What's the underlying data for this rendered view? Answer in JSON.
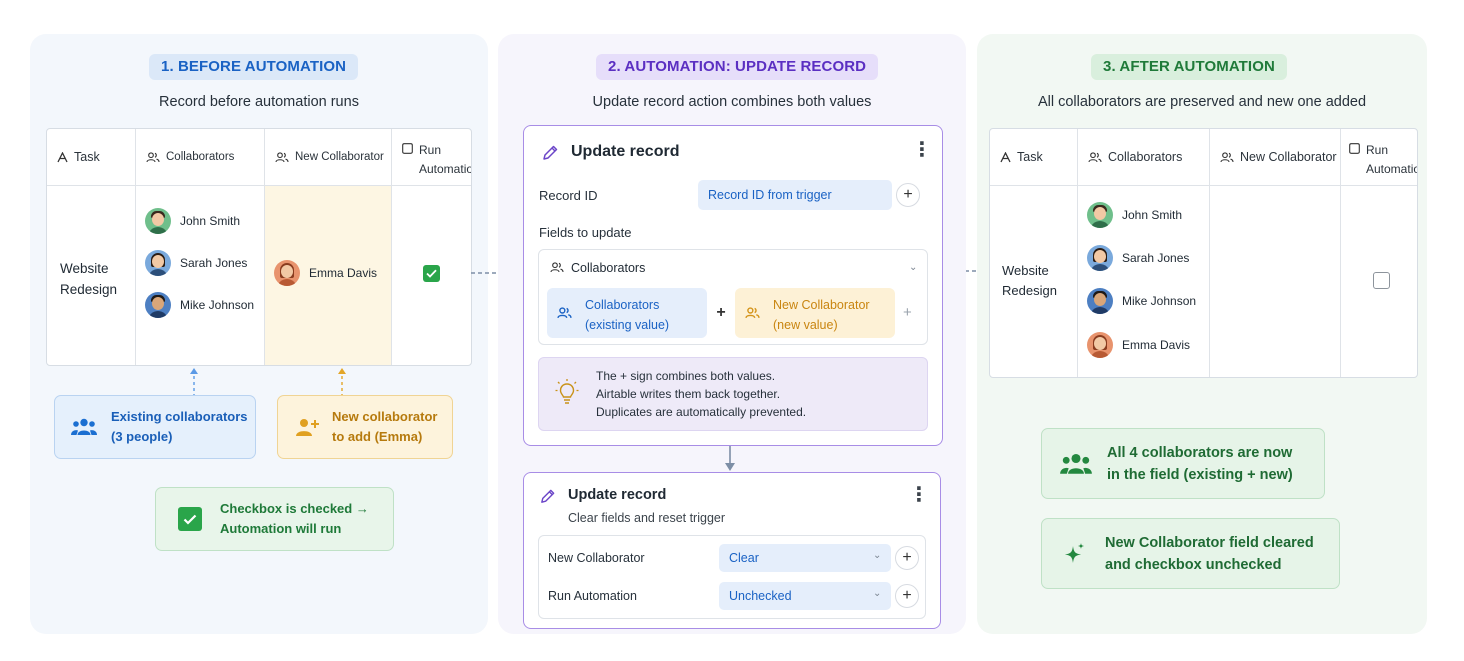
{
  "panel1": {
    "pill": "1. BEFORE AUTOMATION",
    "subtitle": "Record before automation runs",
    "table": {
      "headers": {
        "task": "Task",
        "collaborators": "Collaborators",
        "new_collaborator": "New Collaborator",
        "run": "Run Automation"
      },
      "task_value": "Website Redesign",
      "collaborators": [
        "John Smith",
        "Sarah Jones",
        "Mike Johnson"
      ],
      "new_collaborator": "Emma Davis"
    },
    "note_existing": {
      "line1": "Existing collaborators",
      "line2": "(3 people)"
    },
    "note_new": {
      "line1": "New collaborator",
      "line2": "to add (Emma)"
    },
    "note_checkbox": {
      "line1": "Checkbox is checked →",
      "line2": "Automation will run"
    }
  },
  "panel2": {
    "pill": "2. AUTOMATION: UPDATE RECORD",
    "subtitle": "Update record action combines both values",
    "card1": {
      "title": "Update record",
      "record_id_label": "Record ID",
      "record_id_value": "Record ID from trigger",
      "fields_label": "Fields to update",
      "collab_field": "Collaborators",
      "token_existing": {
        "line1": "Collaborators",
        "line2": "(existing value)"
      },
      "token_new": {
        "line1": "New Collaborator",
        "line2": "(new value)"
      },
      "tip": {
        "line1": "The + sign combines both values.",
        "line2": "Airtable writes them back together.",
        "line3": "Duplicates are automatically prevented."
      }
    },
    "card2": {
      "title": "Update record",
      "subtitle": "Clear fields and reset trigger",
      "rows": [
        {
          "label": "New Collaborator",
          "value": "Clear"
        },
        {
          "label": "Run Automation",
          "value": "Unchecked"
        }
      ]
    }
  },
  "panel3": {
    "pill": "3. AFTER AUTOMATION",
    "subtitle": "All collaborators are preserved and new one added",
    "table": {
      "headers": {
        "task": "Task",
        "collaborators": "Collaborators",
        "new_collaborator": "New Collaborator",
        "run": "Run Automation"
      },
      "task_value": "Website Redesign",
      "collaborators": [
        "John Smith",
        "Sarah Jones",
        "Mike Johnson",
        "Emma Davis"
      ]
    },
    "note_all": {
      "line1": "All 4 collaborators are now",
      "line2": "in the field (existing + new)"
    },
    "note_cleared": {
      "line1": "New Collaborator field cleared",
      "line2": "and checkbox unchecked"
    }
  },
  "colors": {
    "blue_accent": "#1a6fd6",
    "purple_accent": "#6b45c8",
    "green_accent": "#23883f",
    "amber_accent": "#e0a020"
  },
  "icons": [
    "text-icon",
    "people-icon",
    "checkbox-icon",
    "pencil-icon",
    "more-vert-icon",
    "lightbulb-icon",
    "sparkle-icon",
    "group-icon",
    "add-person-icon",
    "check-icon"
  ]
}
